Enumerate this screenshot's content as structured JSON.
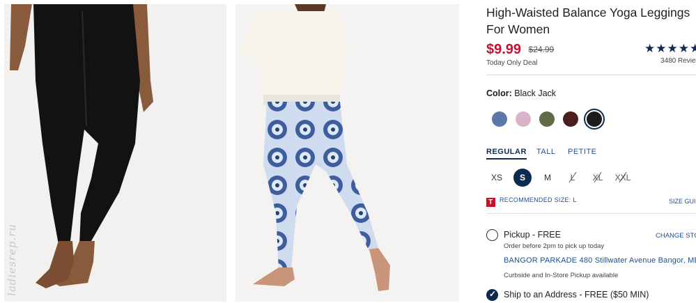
{
  "images": [
    {
      "alt_subject": "black-leggings-photo"
    },
    {
      "alt_subject": "tie-dye-leggings-photo"
    }
  ],
  "watermark": "ladiesrep.ru",
  "product": {
    "title_line1": "High-Waisted Balance Yoga Leggings",
    "title_line2": "For Women",
    "price": "$9.99",
    "original_price": "$24.99",
    "deal_label": "Today Only Deal",
    "rating_stars": "★★★★★",
    "review_count": "3480 Revie"
  },
  "color": {
    "label": "Color:",
    "selected": "Black Jack",
    "swatches": [
      {
        "name": "blue-tie-dye",
        "color": "#5b78a8"
      },
      {
        "name": "pink-tie-dye",
        "color": "#d9b3c8"
      },
      {
        "name": "olive",
        "color": "#5f6b45"
      },
      {
        "name": "brown",
        "color": "#4a1f1c"
      },
      {
        "name": "black-jack",
        "color": "#1c1c1c"
      }
    ]
  },
  "fit_tabs": [
    "REGULAR",
    "TALL",
    "PETITE"
  ],
  "sizes": [
    "XS",
    "S",
    "M",
    "L",
    "XL",
    "XXL"
  ],
  "recommended": {
    "tag": "T",
    "text": "RECOMMENDED SIZE: L",
    "size_guide": "SIZE GUI"
  },
  "pickup": {
    "title": "Pickup - FREE",
    "sub": "Order before 2pm to pick up today",
    "store": "BANGOR PARKADE 480 Stillwater Avenue  Bangor, ME",
    "curbside": "Curbside and In-Store Pickup available",
    "change_store": "CHANGE STO"
  },
  "ship": {
    "title": "Ship to an Address - FREE ($50 MIN)"
  },
  "accent_colors": {
    "price": "#c8102e",
    "navy": "#0d2a4f",
    "link": "#1d4f91"
  }
}
